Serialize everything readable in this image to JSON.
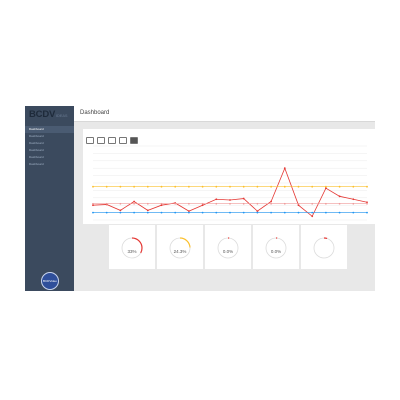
{
  "app": {
    "logo_main": "BCDV",
    "logo_sub": "IDEAS",
    "page_title": "Dashboard"
  },
  "sidebar": {
    "items": [
      {
        "label": "Dashboard",
        "active": true
      },
      {
        "label": "Dashboard",
        "active": false
      },
      {
        "label": "Dashboard",
        "active": false
      },
      {
        "label": "Dashboard",
        "active": false
      },
      {
        "label": "Dashboard",
        "active": false
      },
      {
        "label": "Dashboard",
        "active": false
      }
    ],
    "badge": "BCDVideo"
  },
  "chart_card": {
    "title": "",
    "chips": [
      {
        "label": "",
        "active": false
      },
      {
        "label": "",
        "active": false
      },
      {
        "label": "",
        "active": false
      },
      {
        "label": "",
        "active": false
      },
      {
        "label": "",
        "active": true
      }
    ]
  },
  "chart_data": {
    "type": "line",
    "ylim": [
      0,
      100
    ],
    "x": [
      1,
      2,
      3,
      4,
      5,
      6,
      7,
      8,
      9,
      10,
      11,
      12,
      13,
      14,
      15,
      16,
      17,
      18,
      19,
      20,
      21
    ],
    "series": [
      {
        "color": "#e53935",
        "values": [
          20,
          21,
          13,
          25,
          13,
          20,
          23,
          12,
          20,
          28,
          27,
          29,
          12,
          25,
          70,
          20,
          5,
          43,
          32,
          28,
          24
        ]
      },
      {
        "color": "#fbc02d",
        "values": [
          45,
          45,
          45,
          45,
          45,
          45,
          45,
          45,
          45,
          45,
          45,
          45,
          45,
          45,
          45,
          45,
          45,
          45,
          45,
          45,
          45
        ]
      },
      {
        "color": "#ef9a9a",
        "values": [
          22,
          22,
          22,
          22,
          22,
          22,
          22,
          22,
          22,
          22,
          22,
          22,
          22,
          22,
          22,
          22,
          22,
          22,
          22,
          22,
          22
        ]
      },
      {
        "color": "#2196f3",
        "values": [
          10,
          10,
          10,
          10,
          10,
          10,
          10,
          10,
          10,
          10,
          10,
          10,
          10,
          10,
          10,
          10,
          10,
          10,
          10,
          10,
          10
        ]
      }
    ]
  },
  "stats": [
    {
      "label": "",
      "value": "33%",
      "fraction": 0.33,
      "color": "#e53935"
    },
    {
      "label": "",
      "value": "24.3%",
      "fraction": 0.24,
      "color": "#fbc02d"
    },
    {
      "label": "",
      "value": "0.0%",
      "fraction": 0.0,
      "color": "#e53935"
    },
    {
      "label": "",
      "value": "0.0%",
      "fraction": 0.0,
      "color": "#e53935"
    },
    {
      "label": "",
      "value": "",
      "fraction": 0.05,
      "color": "#e53935"
    }
  ]
}
